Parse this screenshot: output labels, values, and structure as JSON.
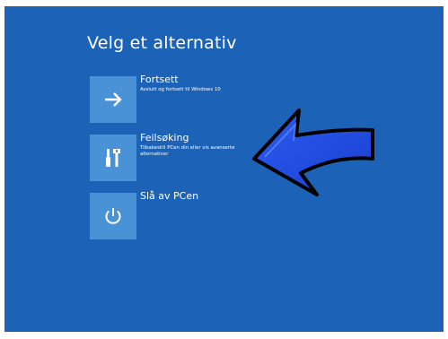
{
  "screen": {
    "heading": "Velg et alternativ",
    "background_color": "#1c63b8",
    "tile_color": "#4a92d6"
  },
  "options": [
    {
      "title": "Fortsett",
      "description": "Avslutt og fortsett til Windows 10",
      "icon": "arrow-right-icon"
    },
    {
      "title": "Feilsøking",
      "description": "Tilbakestill PCen din eller vis avanserte alternativer",
      "icon": "tools-icon"
    },
    {
      "title": "Slå av PCen",
      "description": "",
      "icon": "power-icon"
    }
  ],
  "annotation": {
    "icon": "pointer-arrow-icon",
    "color": "#1f4be0"
  }
}
